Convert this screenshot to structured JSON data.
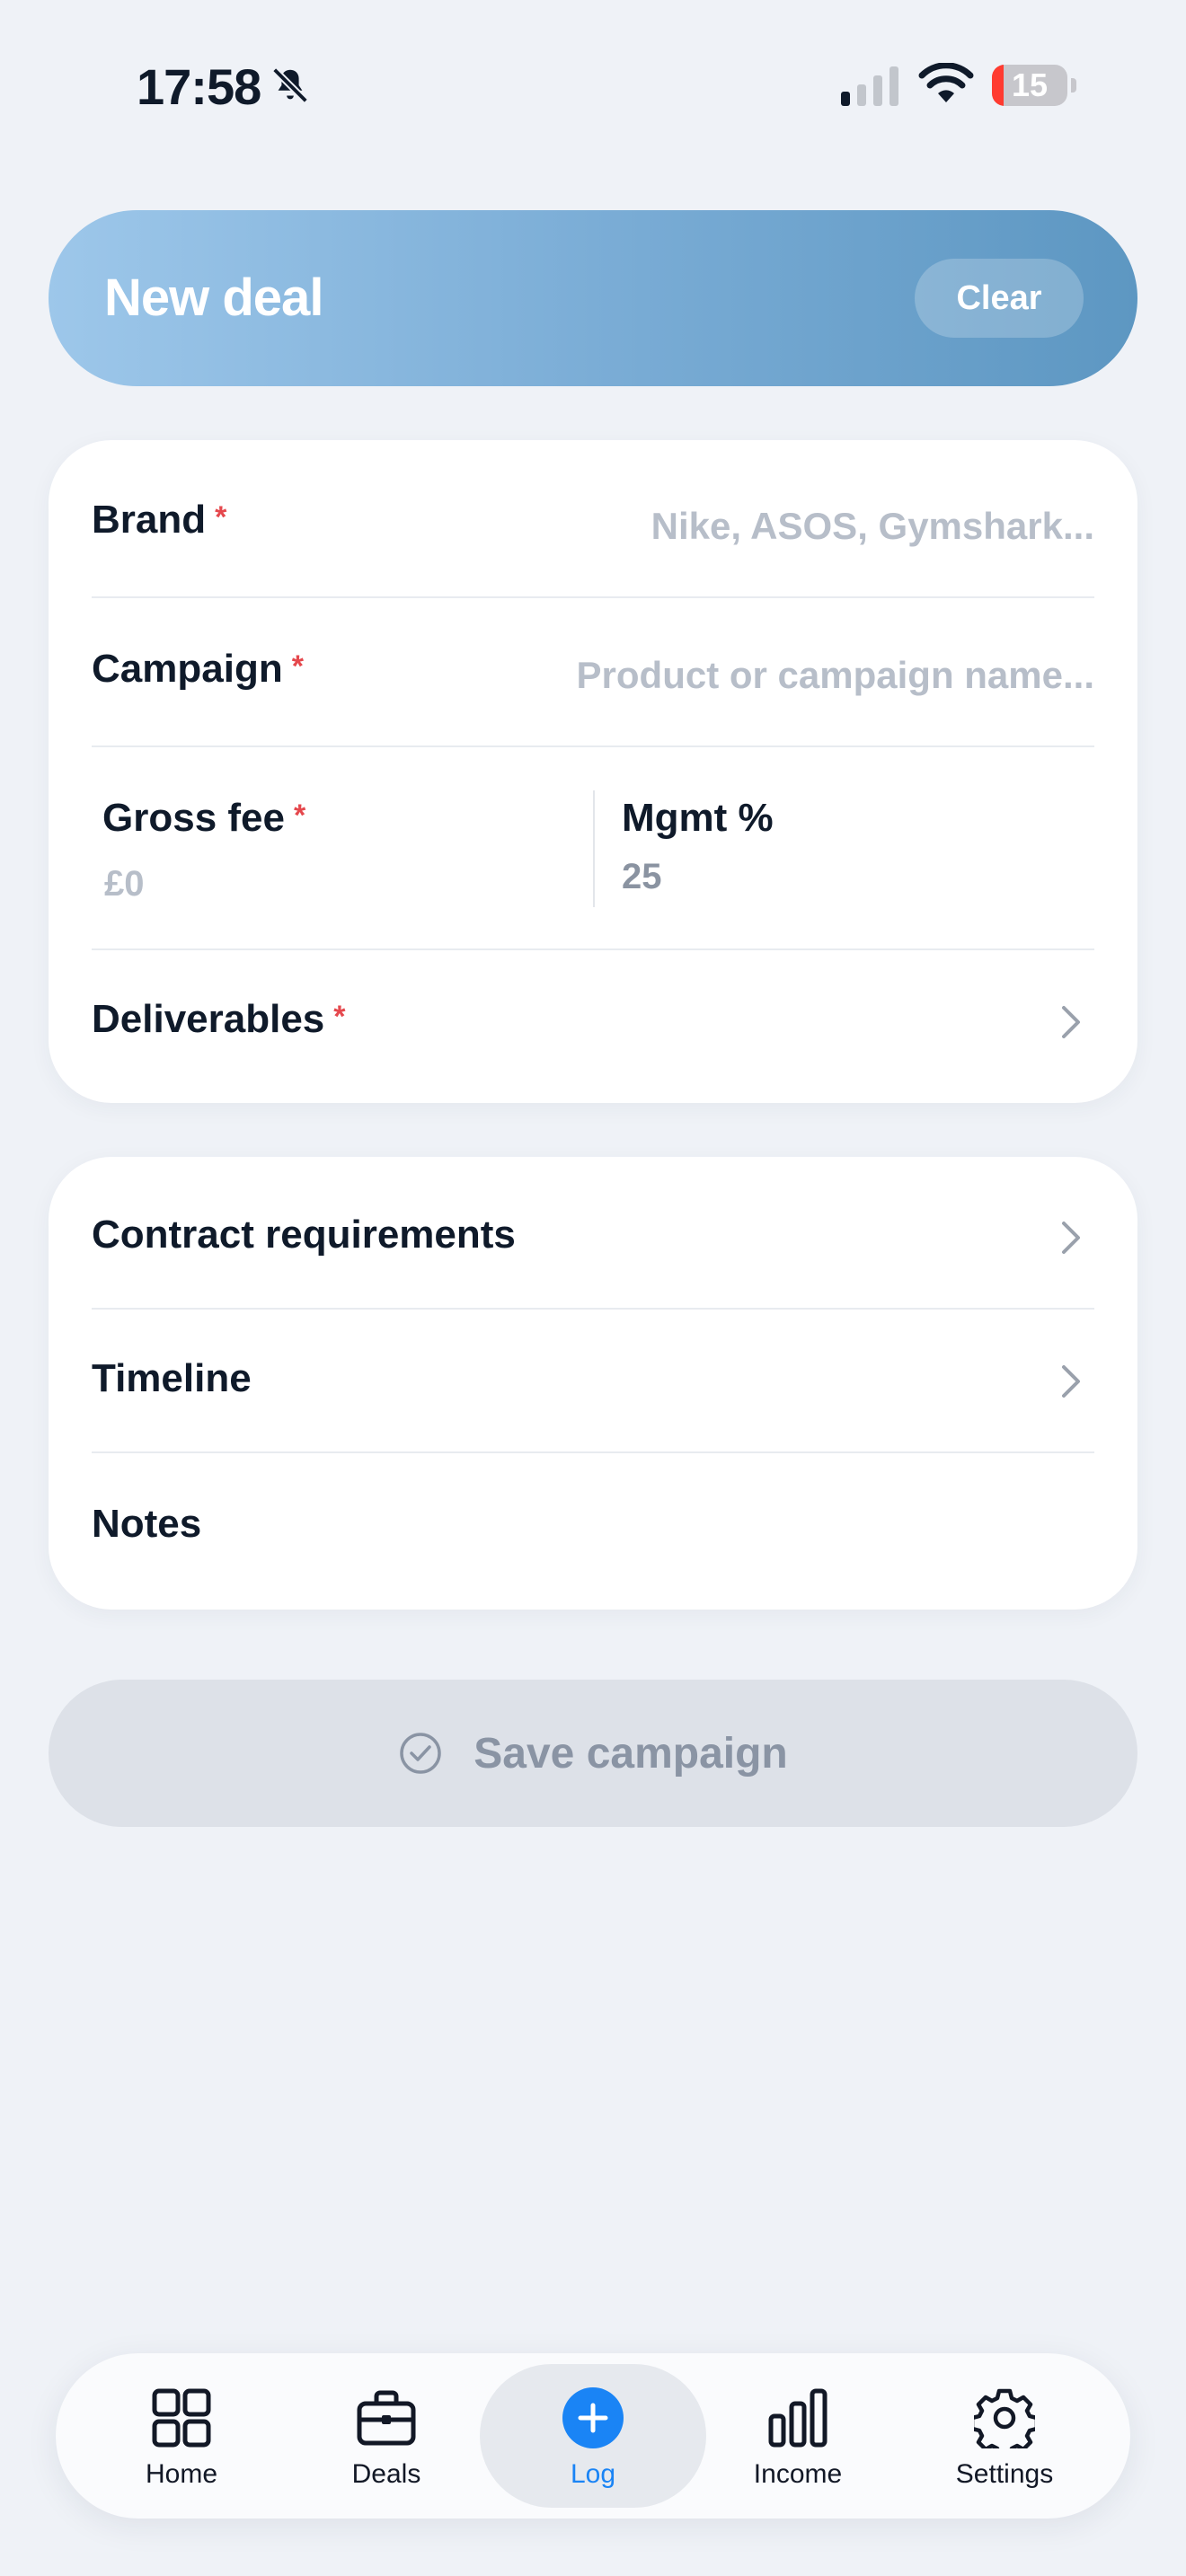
{
  "status_bar": {
    "time": "17:58",
    "battery": "15",
    "battery_level": 0.15,
    "battery_color": "#ff3b30"
  },
  "header": {
    "title": "New deal",
    "clear_label": "Clear"
  },
  "form": {
    "brand": {
      "label": "Brand",
      "required": "*",
      "placeholder": "Nike, ASOS, Gymshark..."
    },
    "campaign": {
      "label": "Campaign",
      "required": "*",
      "placeholder": "Product or campaign name..."
    },
    "gross_fee": {
      "label": "Gross fee",
      "required": "*",
      "placeholder": "£0"
    },
    "mgmt": {
      "label": "Mgmt %",
      "value": "25"
    },
    "deliverables": {
      "label": "Deliverables",
      "required": "*"
    }
  },
  "extras": {
    "contract": {
      "label": "Contract requirements"
    },
    "timeline": {
      "label": "Timeline"
    },
    "notes": {
      "label": "Notes"
    }
  },
  "save": {
    "label": "Save campaign"
  },
  "tabs": [
    {
      "label": "Home",
      "icon": "grid-icon"
    },
    {
      "label": "Deals",
      "icon": "briefcase-icon"
    },
    {
      "label": "Log",
      "icon": "plus-circle-icon"
    },
    {
      "label": "Income",
      "icon": "bar-chart-icon"
    },
    {
      "label": "Settings",
      "icon": "gear-icon"
    }
  ],
  "colors": {
    "accent": "#1a84f5",
    "required": "#e5484d",
    "header_gradient_start": "#9dc7ea",
    "header_gradient_end": "#5d97c2",
    "background": "#eff2f7"
  }
}
